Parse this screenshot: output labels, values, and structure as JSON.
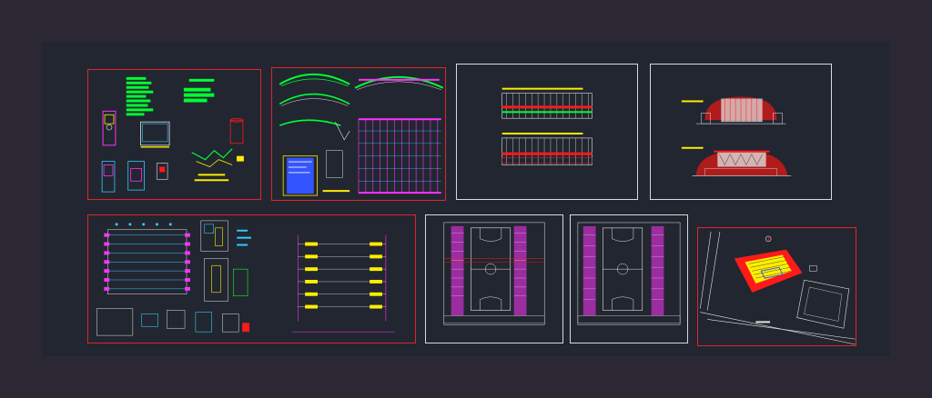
{
  "colors": {
    "background": "#2b2834",
    "model_space": "#222630",
    "sheet_border_red": "#e0242c",
    "sheet_border_white": "#d9d9d9",
    "cad_green": "#00ff33",
    "cad_magenta": "#ff33ff",
    "cad_cyan": "#33ccff",
    "cad_yellow": "#ffee00",
    "cad_red": "#ff1a1a",
    "cad_white": "#e6e6e6",
    "cad_blue": "#3355ff"
  },
  "sheets": [
    {
      "id": "details",
      "border": "red"
    },
    {
      "id": "roof-arches",
      "border": "red"
    },
    {
      "id": "elevations-side",
      "border": "white"
    },
    {
      "id": "elevations-front",
      "border": "white"
    },
    {
      "id": "foundation-plan",
      "border": "red"
    },
    {
      "id": "court-plan-1",
      "border": "white"
    },
    {
      "id": "court-plan-2",
      "border": "white"
    },
    {
      "id": "site-plan",
      "border": "red"
    }
  ]
}
